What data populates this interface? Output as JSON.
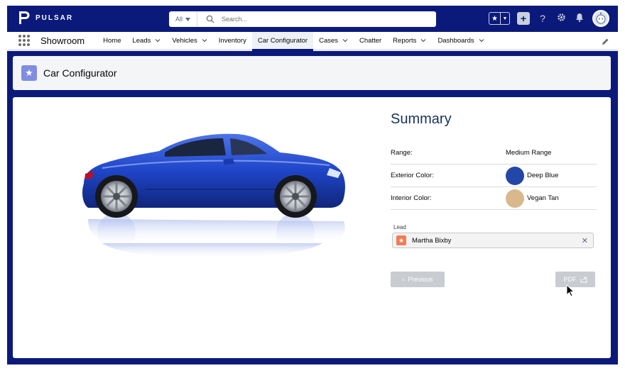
{
  "header": {
    "brand": "PULSAR",
    "search_scope": "All",
    "search_placeholder": "Search..."
  },
  "nav": {
    "app_name": "Showroom",
    "items": [
      {
        "label": "Home",
        "dropdown": false
      },
      {
        "label": "Leads",
        "dropdown": true
      },
      {
        "label": "Vehicles",
        "dropdown": true
      },
      {
        "label": "Inventory",
        "dropdown": false
      },
      {
        "label": "Car Configurator",
        "dropdown": false,
        "active": true
      },
      {
        "label": "Cases",
        "dropdown": true
      },
      {
        "label": "Chatter",
        "dropdown": false
      },
      {
        "label": "Reports",
        "dropdown": true
      },
      {
        "label": "Dashboards",
        "dropdown": true
      }
    ]
  },
  "page": {
    "title": "Car Configurator"
  },
  "summary": {
    "title": "Summary",
    "rows": [
      {
        "label": "Range:",
        "value": "Medium Range"
      },
      {
        "label": "Exterior Color:",
        "value": "Deep Blue",
        "swatch": "#2446a8"
      },
      {
        "label": "Interior Color:",
        "value": "Vegan Tan",
        "swatch": "#d9b88e"
      }
    ],
    "lead_label": "Lead",
    "lead_value": "Martha Bixby"
  },
  "buttons": {
    "previous": "Previous",
    "pdf": "PDF"
  },
  "colors": {
    "brand_navy": "#0b1a7a",
    "car_blue": "#1f45c8",
    "page_icon": "#7f8de1",
    "lead_icon": "#ef7d56"
  }
}
